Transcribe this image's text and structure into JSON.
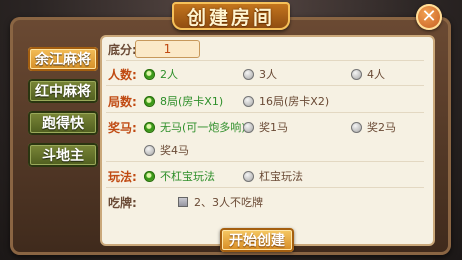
{
  "dialog": {
    "title": "创建房间",
    "close_symbol": "✕"
  },
  "tabs": [
    {
      "label": "余江麻将",
      "active": true
    },
    {
      "label": "红中麻将",
      "active": false
    },
    {
      "label": "跑得快",
      "active": false
    },
    {
      "label": "斗地主",
      "active": false
    }
  ],
  "form": {
    "base_label": "底分:",
    "base_value": "1",
    "players_label": "人数:",
    "players_options": [
      "2人",
      "3人",
      "4人"
    ],
    "rounds_label": "局数:",
    "rounds_options": [
      "8局(房卡X1)",
      "16局(房卡X2)"
    ],
    "horse_label": "奖马:",
    "horse_options": [
      "无马(可一炮多响)",
      "奖1马",
      "奖2马",
      "奖4马"
    ],
    "play_label": "玩法:",
    "play_options": [
      "不杠宝玩法",
      "杠宝玩法"
    ],
    "eat_label": "吃牌:",
    "eat_option": "2、3人不吃牌"
  },
  "actions": {
    "start_label": "开始创建"
  },
  "colors": {
    "selected": "#2e8f2a",
    "label": "#c04a12",
    "tab_active": "#f6c25d"
  }
}
